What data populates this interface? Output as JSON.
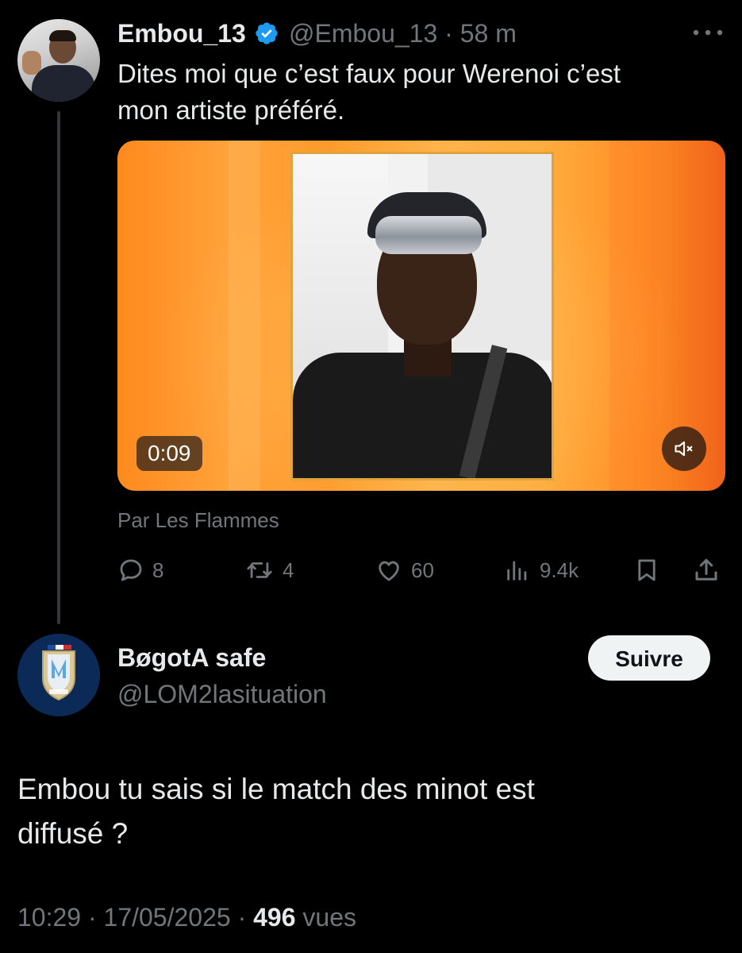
{
  "tweet": {
    "author_name": "Embou_13",
    "handle_time": "@Embou_13 · 58 m",
    "text": "Dites moi que c’est faux pour Werenoi c’est\nmon artiste préféré.",
    "video": {
      "duration": "0:09",
      "muted": true
    },
    "source_label": "Par Les Flammes",
    "actions": {
      "replies": "8",
      "reposts": "4",
      "likes": "60",
      "views": "9.4k"
    },
    "colors": {
      "verified": "#1d9bf0",
      "muted_text": "#71767b"
    }
  },
  "reply": {
    "name": "BøgotA safe",
    "handle": "@LOM2lasituation",
    "follow_label": "Suivre",
    "text": "Embou  tu sais si le match  des minot est\ndiffusé ?",
    "meta": {
      "time_date": "10:29 · 17/05/2025 · ",
      "views_count": "496",
      "views_label": " vues"
    }
  },
  "icons": [
    "verified-icon",
    "more-icon",
    "mute-icon",
    "reply-icon",
    "repost-icon",
    "like-icon",
    "views-icon",
    "bookmark-icon",
    "share-icon"
  ]
}
